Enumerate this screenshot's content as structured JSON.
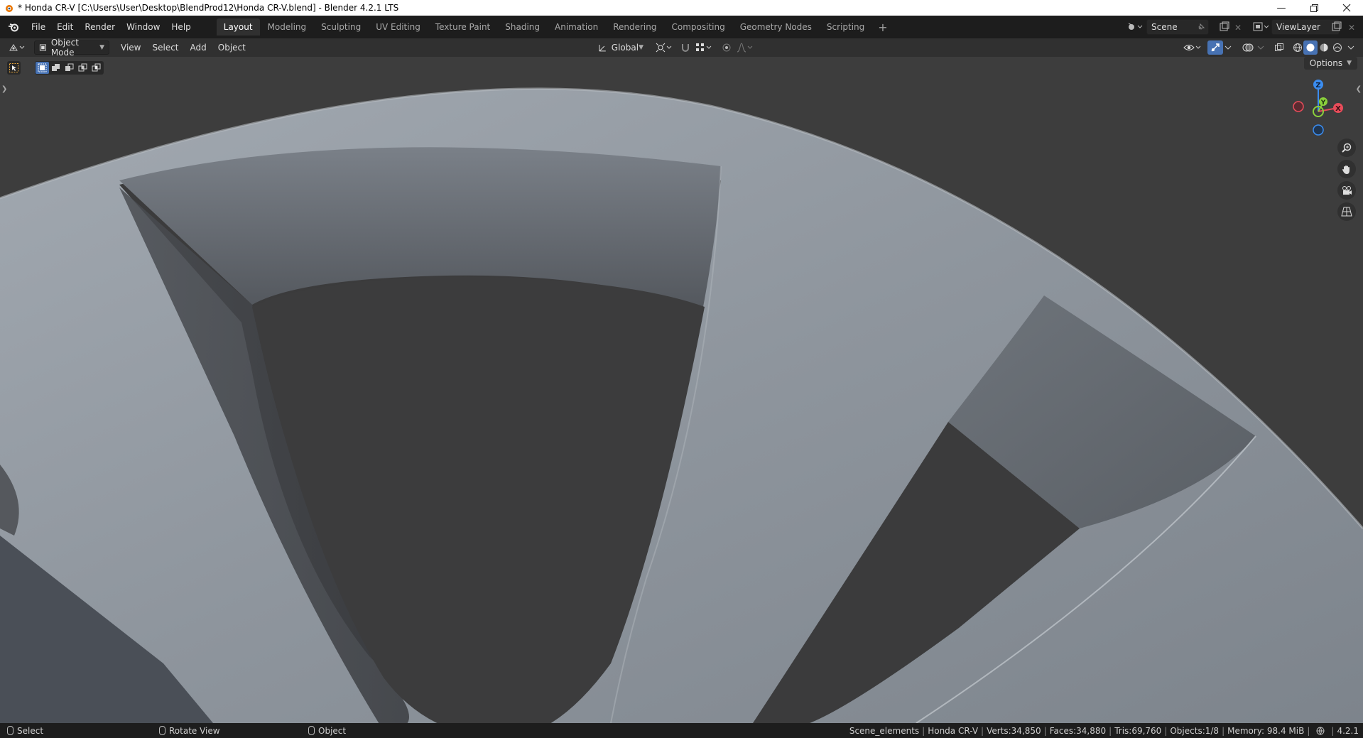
{
  "window": {
    "title": "* Honda CR-V [C:\\Users\\User\\Desktop\\BlendProd12\\Honda CR-V.blend] - Blender 4.2.1 LTS",
    "controls": [
      "minimize-icon",
      "restore-icon",
      "close-icon"
    ]
  },
  "menu": [
    "File",
    "Edit",
    "Render",
    "Window",
    "Help"
  ],
  "workspaces": [
    {
      "label": "Layout",
      "active": true
    },
    {
      "label": "Modeling",
      "active": false
    },
    {
      "label": "Sculpting",
      "active": false
    },
    {
      "label": "UV Editing",
      "active": false
    },
    {
      "label": "Texture Paint",
      "active": false
    },
    {
      "label": "Shading",
      "active": false
    },
    {
      "label": "Animation",
      "active": false
    },
    {
      "label": "Rendering",
      "active": false
    },
    {
      "label": "Compositing",
      "active": false
    },
    {
      "label": "Geometry Nodes",
      "active": false
    },
    {
      "label": "Scripting",
      "active": false
    }
  ],
  "add_workspace": "+",
  "scene": {
    "name": "Scene"
  },
  "view_layer": {
    "name": "ViewLayer"
  },
  "header": {
    "mode": "Object Mode",
    "menus": [
      "View",
      "Select",
      "Add",
      "Object"
    ],
    "transform_orientation": "Global",
    "options": "Options"
  },
  "gizmo": {
    "z": "Z",
    "y": "Y",
    "x": "X",
    "colors": {
      "x": "#e84c5a",
      "y": "#8bd13c",
      "z": "#3b8df0"
    }
  },
  "statusbar": {
    "hint_select": "Select",
    "hint_rotate": "Rotate View",
    "hint_object": "Object",
    "collection": "Scene_elements",
    "object": "Honda CR-V",
    "verts": "Verts:34,850",
    "faces": "Faces:34,880",
    "tris": "Tris:69,760",
    "objects": "Objects:1/8",
    "memory": "Memory: 98.4 MiB",
    "version": "4.2.1"
  }
}
